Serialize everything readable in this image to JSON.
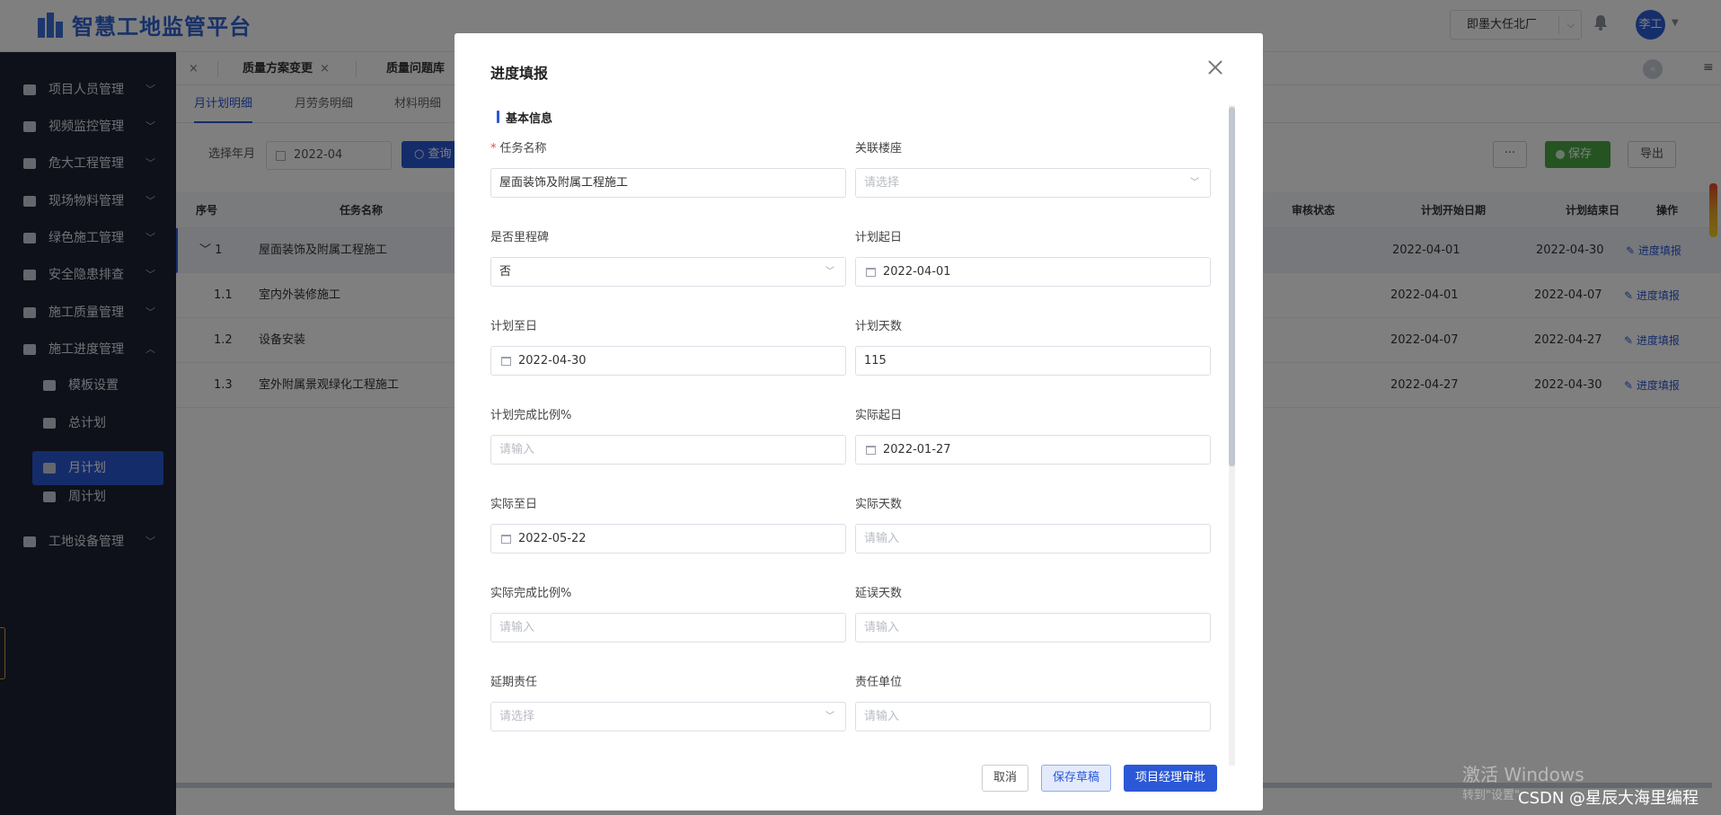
{
  "header": {
    "app_title": "智慧工地监管平台",
    "project_select": "即墨大任北厂",
    "avatar_text": "李工"
  },
  "sidebar": {
    "items": [
      {
        "label": "项目人员管理"
      },
      {
        "label": "视频监控管理"
      },
      {
        "label": "危大工程管理"
      },
      {
        "label": "现场物料管理"
      },
      {
        "label": "绿色施工管理"
      },
      {
        "label": "安全隐患排查"
      },
      {
        "label": "施工质量管理"
      },
      {
        "label": "施工进度管理"
      }
    ],
    "sub_items": [
      {
        "label": "模板设置"
      },
      {
        "label": "总计划"
      },
      {
        "label": "月计划"
      },
      {
        "label": "周计划"
      }
    ],
    "last_item": "工地设备管理"
  },
  "tabs": [
    {
      "label": "质量方案变更"
    },
    {
      "label": "质量问题库"
    }
  ],
  "subtabs": [
    "月计划明细",
    "月劳务明细",
    "材料明细"
  ],
  "toolbar": {
    "month_label": "选择年月",
    "month_value": "2022-04",
    "query": "查询",
    "more": "···",
    "save": "保存",
    "export": "导出"
  },
  "table": {
    "headers": [
      "序号",
      "任务名称",
      "审核状态",
      "计划开始日期",
      "计划结束日",
      "操作"
    ],
    "rows": [
      {
        "no": "1",
        "name": "屋面装饰及附属工程施工",
        "start": "2022-04-01",
        "end": "2022-04-30",
        "op": "进度填报"
      },
      {
        "no": "1.1",
        "name": "室内外装修施工",
        "start": "2022-04-01",
        "end": "2022-04-07",
        "op": "进度填报"
      },
      {
        "no": "1.2",
        "name": "设备安装",
        "start": "2022-04-07",
        "end": "2022-04-27",
        "op": "进度填报"
      },
      {
        "no": "1.3",
        "name": "室外附属景观绿化工程施工",
        "start": "2022-04-27",
        "end": "2022-04-30",
        "op": "进度填报"
      }
    ]
  },
  "modal": {
    "title": "进度填报",
    "section": "基本信息",
    "fields": {
      "task_name": {
        "label": "任务名称",
        "value": "屋面装饰及附属工程施工"
      },
      "building": {
        "label": "关联楼座",
        "placeholder": "请选择"
      },
      "milestone": {
        "label": "是否里程碑",
        "value": "否"
      },
      "plan_start": {
        "label": "计划起日",
        "value": "2022-04-01"
      },
      "plan_end": {
        "label": "计划至日",
        "value": "2022-04-30"
      },
      "plan_days": {
        "label": "计划天数",
        "value": "115"
      },
      "plan_ratio": {
        "label": "计划完成比例%",
        "placeholder": "请输入"
      },
      "actual_start": {
        "label": "实际起日",
        "value": "2022-01-27"
      },
      "actual_end": {
        "label": "实际至日",
        "value": "2022-05-22"
      },
      "actual_days": {
        "label": "实际天数",
        "placeholder": "请输入"
      },
      "actual_ratio": {
        "label": "实际完成比例%",
        "placeholder": "请输入"
      },
      "delay_days": {
        "label": "延误天数",
        "placeholder": "请输入"
      },
      "delay_resp": {
        "label": "延期责任",
        "placeholder": "请选择"
      },
      "resp_unit": {
        "label": "责任单位",
        "placeholder": "请输入"
      }
    },
    "buttons": {
      "cancel": "取消",
      "draft": "保存草稿",
      "submit": "项目经理审批"
    }
  },
  "overlay_text": {
    "win_line1": "激活 Windows",
    "win_line2": "转到\"设置\"",
    "csdn": "CSDN @星辰大海里编程"
  },
  "colors": {
    "primary": "#2b58d6",
    "sidebar_bg": "#1c2333",
    "success": "#4aa845"
  }
}
